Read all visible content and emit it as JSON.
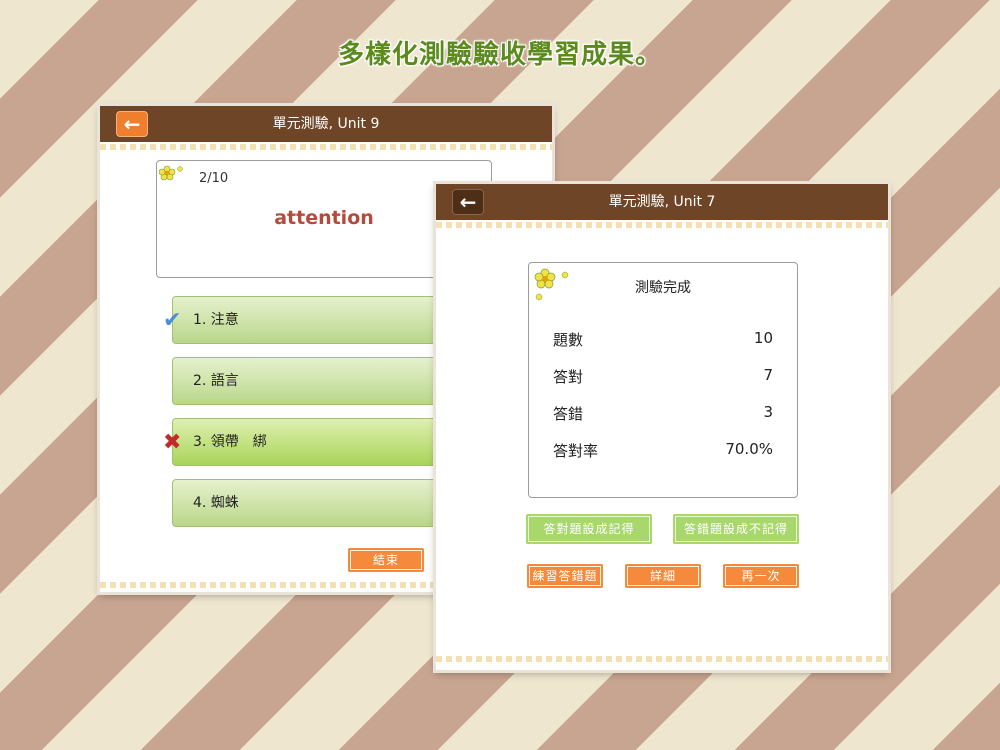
{
  "headline": "多樣化測驗驗收學習成果。",
  "quiz_window": {
    "title": "單元測驗, Unit 9",
    "back_icon": "arrow-left-icon",
    "progress": "2/10",
    "word": "attention",
    "choices": [
      {
        "label": "1. 注意",
        "mark": "check-icon"
      },
      {
        "label": "2. 語言",
        "mark": ""
      },
      {
        "label": "3. 領帶　綁",
        "mark": "cross-icon"
      },
      {
        "label": "4. 蜘蛛",
        "mark": ""
      }
    ],
    "end_button": "結束"
  },
  "result_window": {
    "title": "單元測驗, Unit 7",
    "back_icon": "arrow-left-icon",
    "card_title": "測驗完成",
    "stats": [
      {
        "label": "題數",
        "value": "10"
      },
      {
        "label": "答對",
        "value": "7"
      },
      {
        "label": "答錯",
        "value": "3"
      },
      {
        "label": "答對率",
        "value": "70.0%"
      }
    ],
    "buttons": {
      "mark_correct": "答對題設成記得",
      "mark_wrong": "答錯題設成不記得",
      "practice_wrong": "練習答錯題",
      "details": "詳細",
      "again": "再一次"
    }
  },
  "colors": {
    "titlebar": "#6e4526",
    "accent_orange": "#f58a3c",
    "accent_green": "#a8d86b",
    "word_red": "#b34a3c",
    "headline_green": "#5b8a1d"
  }
}
